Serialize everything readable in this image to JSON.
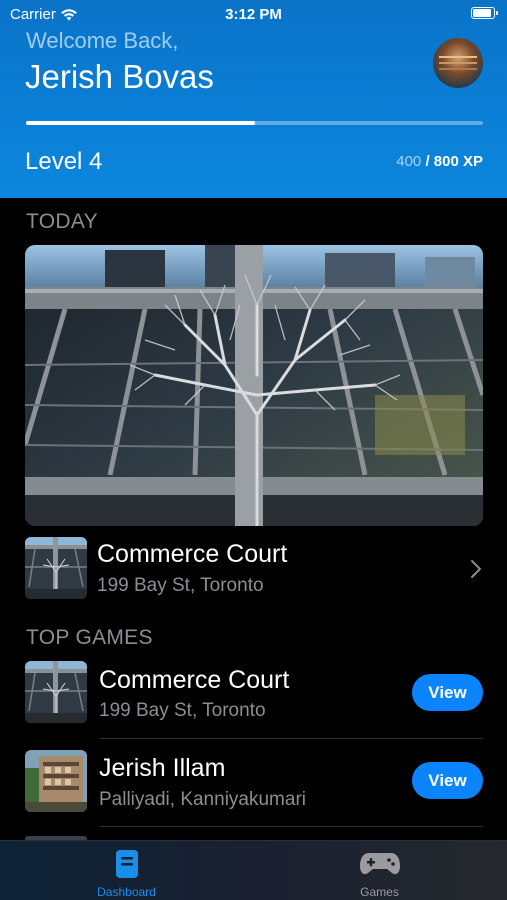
{
  "status_bar": {
    "carrier": "Carrier",
    "time": "3:12 PM",
    "battery_level": 0.9
  },
  "header": {
    "welcome": "Welcome Back,",
    "user_name": "Jerish Bovas",
    "level": "Level 4",
    "xp_current": "400",
    "xp_total": "/ 800 XP",
    "progress": 0.5
  },
  "today": {
    "section_title": "TODAY",
    "place": {
      "title": "Commerce Court",
      "subtitle": "199 Bay St, Toronto"
    }
  },
  "top_games": {
    "section_title": "TOP GAMES",
    "items": [
      {
        "title": "Commerce Court",
        "subtitle": "199 Bay St, Toronto",
        "button": "View"
      },
      {
        "title": "Jerish Illam",
        "subtitle": "Palliyadi, Kanniyakumari",
        "button": "View"
      }
    ]
  },
  "tabbar": {
    "tabs": [
      {
        "label": "Dashboard",
        "icon": "dashboard-icon",
        "active": true
      },
      {
        "label": "Games",
        "icon": "gamepad-icon",
        "active": false
      }
    ]
  },
  "colors": {
    "header_blue": "#0b7fd6",
    "accent": "#0a84ff",
    "active_tab": "#1a8fe8",
    "inactive_tab": "#9a9aa0"
  }
}
